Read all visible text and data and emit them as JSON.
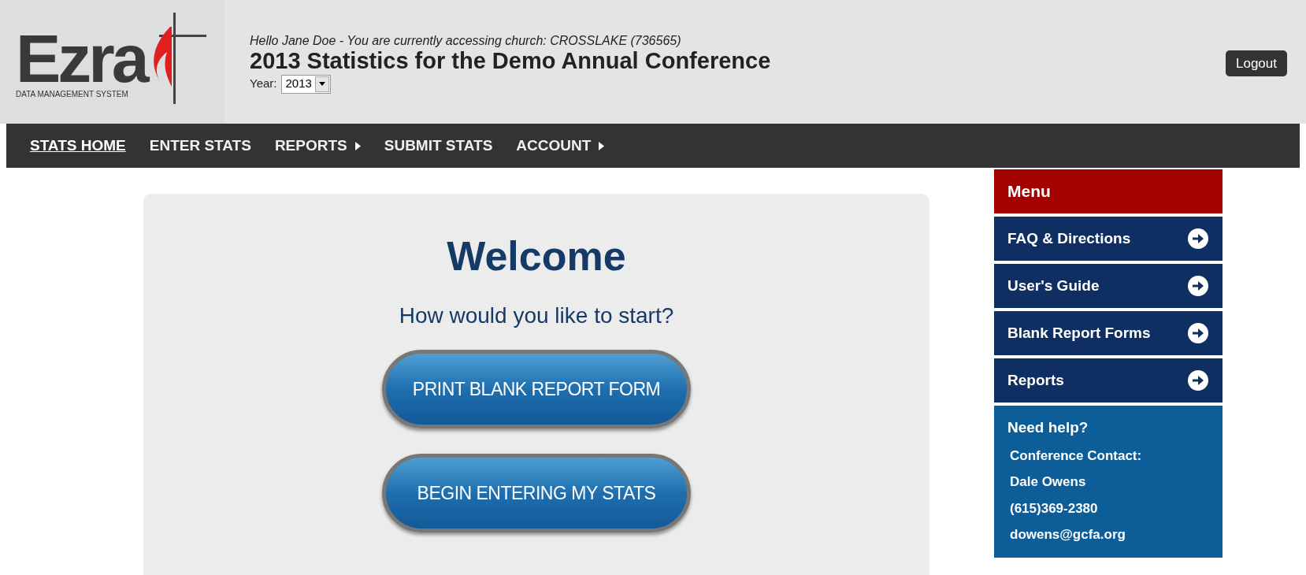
{
  "logo": {
    "name": "Ezra",
    "tagline": "DATA MANAGEMENT SYSTEM"
  },
  "header": {
    "greeting": "Hello Jane Doe - You are currently accessing church: CROSSLAKE (736565)",
    "title": "2013 Statistics for the Demo Annual Conference",
    "year_label": "Year:",
    "year_value": "2013",
    "logout": "Logout"
  },
  "nav": [
    {
      "label": "STATS HOME",
      "selected": true,
      "submenu": false
    },
    {
      "label": "ENTER STATS",
      "selected": false,
      "submenu": false
    },
    {
      "label": "REPORTS",
      "selected": false,
      "submenu": true
    },
    {
      "label": "SUBMIT STATS",
      "selected": false,
      "submenu": false
    },
    {
      "label": "ACCOUNT",
      "selected": false,
      "submenu": true
    }
  ],
  "welcome": {
    "title": "Welcome",
    "subtitle": "How would you like to start?",
    "buttons": [
      "PRINT BLANK REPORT FORM",
      "BEGIN ENTERING MY STATS"
    ]
  },
  "sidebar": {
    "title": "Menu",
    "items": [
      "FAQ & Directions",
      "User's Guide",
      "Blank Report Forms",
      "Reports"
    ],
    "help": {
      "title": "Need help?",
      "lines": [
        "Conference Contact:",
        "Dale Owens",
        "(615)369-2380",
        "dowens@gcfa.org"
      ]
    }
  }
}
